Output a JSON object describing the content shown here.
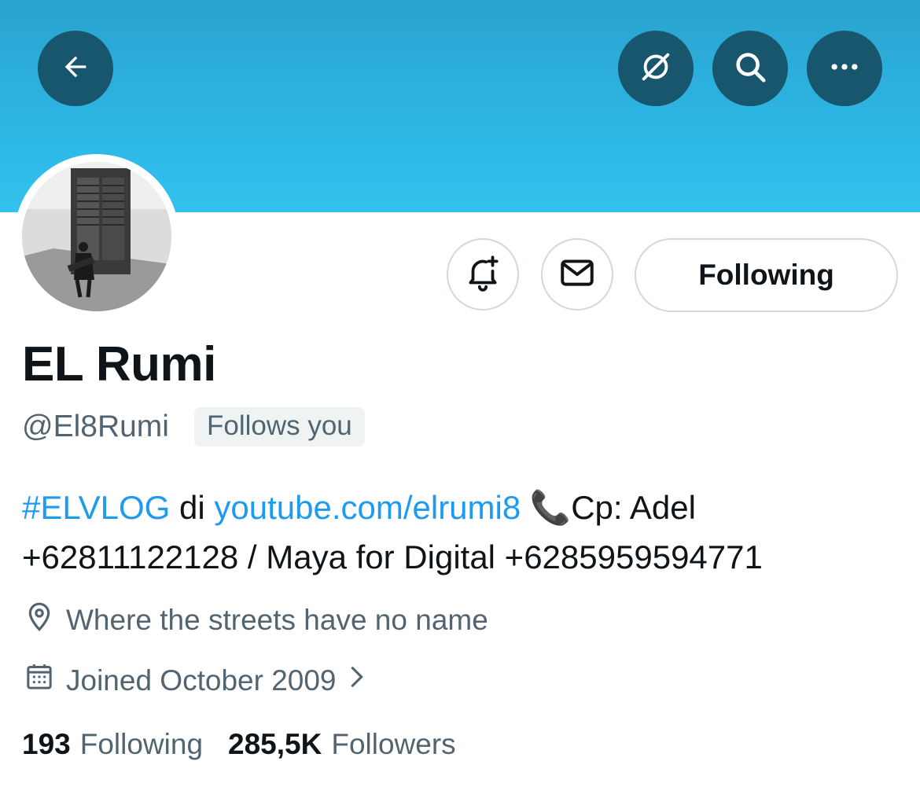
{
  "header": {
    "back_icon": "arrow-left-icon",
    "actions": [
      "no-notifications-icon",
      "search-icon",
      "more-horizontal-icon"
    ]
  },
  "profile": {
    "display_name": "EL Rumi",
    "handle": "@El8Rumi",
    "follows_you": "Follows you",
    "following_button": "Following",
    "bio": {
      "hashtag": "#ELVLOG",
      "di": " di ",
      "link": "youtube.com/elrumi8",
      "phone_emoji": " 📞",
      "rest": "Cp: Adel +62811122128 / Maya for Digital +6285959594771"
    },
    "location": "Where the streets have no name",
    "joined": "Joined October 2009",
    "stats": {
      "following_count": "193",
      "following_label": "Following",
      "followers_count": "285,5K",
      "followers_label": "Followers"
    }
  },
  "colors": {
    "banner": "#2eb9e8",
    "button_dark": "#18566e",
    "link": "#1d9bf0",
    "muted": "#536471"
  }
}
